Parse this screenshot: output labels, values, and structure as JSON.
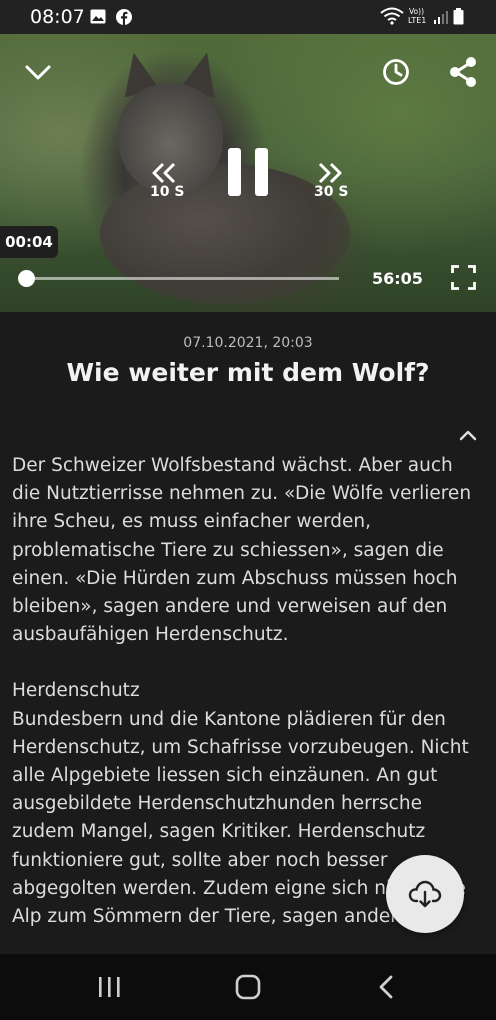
{
  "status_bar": {
    "time": "08:07",
    "left_icons": [
      "image-icon",
      "facebook-icon"
    ],
    "right_icons": [
      "wifi-icon",
      "volte-lte-icon",
      "signal-icon",
      "battery-icon"
    ],
    "network_label": "Vo)) LTE1"
  },
  "player": {
    "current_time": "00:04",
    "duration": "56:05",
    "rewind_label": "10 S",
    "forward_label": "30 S",
    "progress_fraction": 0.001,
    "state": "playing"
  },
  "article": {
    "date": "07.10.2021, 20:03",
    "title": "Wie weiter mit dem Wolf?",
    "paragraph_1": "Der Schweizer Wolfsbestand wächst. Aber auch die Nutztierrisse nehmen zu. «Die Wölfe verlieren ihre Scheu, es muss einfacher werden, problematische Tiere zu schiessen», sagen die einen. «Die Hürden zum Abschuss müssen hoch bleiben», sagen andere und verweisen auf den ausbaufähigen Herdenschutz.",
    "section_heading": "Herdenschutz",
    "paragraph_2": "Bundesbern und die Kantone plädieren für den Herdenschutz, um Schafrisse vorzubeugen. Nicht alle Alpgebiete liessen sich einzäunen. An gut ausgebildete Herdenschutzhunden herrsche zudem Mangel, sagen Kritiker. Herdenschutz funktioniere gut, sollte aber noch besser abgegolten werden. Zudem eigne sich nicht jede Alp zum Sömmern der Tiere, sagen andere."
  }
}
